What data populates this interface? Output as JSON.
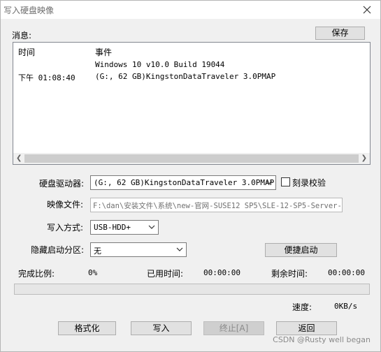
{
  "window": {
    "title": "写入硬盘映像"
  },
  "messages": {
    "label": "消息:",
    "save_label": "保存",
    "col_time": "时间",
    "col_event": "事件",
    "rows": [
      {
        "time": "",
        "event": "Windows 10 v10.0 Build 19044"
      },
      {
        "time": "下午 01:08:40",
        "event": "(G:, 62 GB)KingstonDataTraveler 3.0PMAP"
      }
    ]
  },
  "form": {
    "drive_label": "硬盘驱动器:",
    "drive_value": "(G:, 62 GB)KingstonDataTraveler 3.0PMAP",
    "verify_label": "刻录校验",
    "verify_checked": false,
    "image_label": "映像文件:",
    "image_value": "F:\\dan\\安装文件\\系统\\new-官网-SUSE12 SP5\\SLE-12-SP5-Server-",
    "write_mode_label": "写入方式:",
    "write_mode_value": "USB-HDD+",
    "hidden_partition_label": "隐藏启动分区:",
    "hidden_partition_value": "无",
    "quick_boot_label": "便捷启动"
  },
  "status": {
    "complete_label": "完成比例:",
    "complete_value": "0%",
    "elapsed_label": "已用时间:",
    "elapsed_value": "00:00:00",
    "remaining_label": "剩余时间:",
    "remaining_value": "00:00:00",
    "progress_fraction": 0,
    "speed_label": "速度:",
    "speed_value": "0KB/s"
  },
  "actions": {
    "format": "格式化",
    "write": "写入",
    "stop": "终止[A]",
    "back": "返回"
  },
  "watermark": "CSDN @Rusty well began"
}
